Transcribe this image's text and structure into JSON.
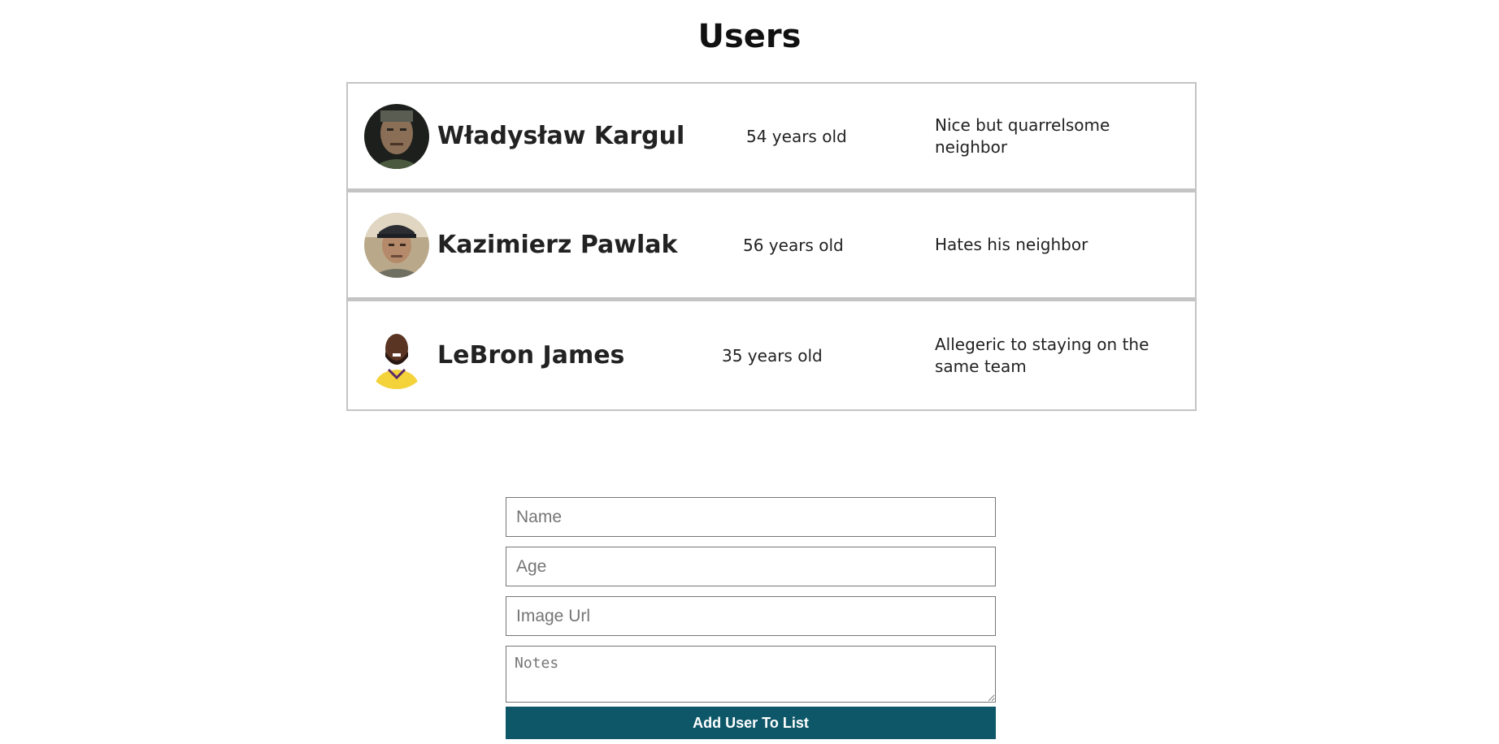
{
  "page": {
    "title": "Users"
  },
  "users": [
    {
      "name": "Władysław Kargul",
      "age": "54 years old",
      "notes": "Nice but quarrelsome neighbor",
      "avatar_icon": "man-portrait-icon"
    },
    {
      "name": "Kazimierz Pawlak",
      "age": "56 years old",
      "notes": "Hates his neighbor",
      "avatar_icon": "man-with-cap-portrait-icon"
    },
    {
      "name": "LeBron James",
      "age": "35 years old",
      "notes": "Allegeric to staying on the same team",
      "avatar_icon": "basketball-player-portrait-icon"
    }
  ],
  "form": {
    "name_placeholder": "Name",
    "age_placeholder": "Age",
    "image_url_placeholder": "Image Url",
    "notes_placeholder": "Notes",
    "submit_label": "Add User To List"
  },
  "colors": {
    "button_background": "#0e5769",
    "card_border": "#c4c4c4"
  }
}
